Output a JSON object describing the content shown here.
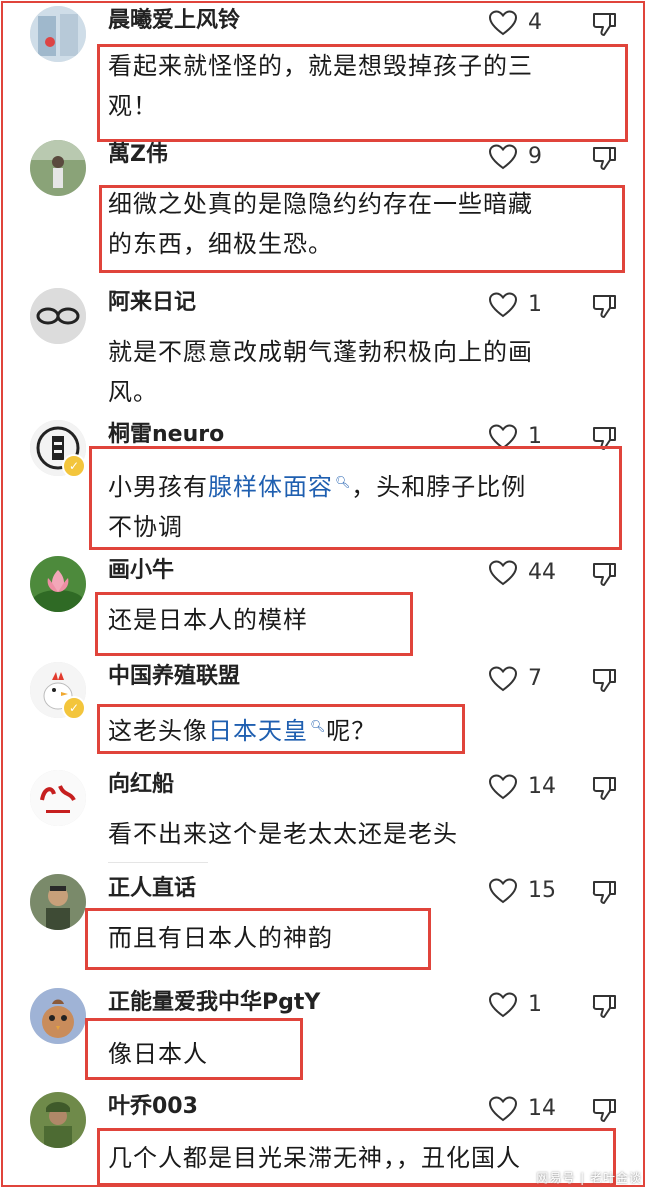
{
  "comments": [
    {
      "user": "晨曦爱上风铃",
      "likes": "4",
      "avatar": "window-scene-avatar",
      "text_lines": [
        "看起来就怪怪的，就是想毁掉孩子的三",
        "观！"
      ]
    },
    {
      "user": "萬Z伟",
      "likes": "9",
      "avatar": "person-outdoor-avatar",
      "text_lines": [
        "细微之处真的是隐隐约约存在一些暗藏",
        "的东西，细极生恐。"
      ]
    },
    {
      "user": "阿来日记",
      "likes": "1",
      "avatar": "glasses-avatar",
      "text_lines": [
        "就是不愿意改成朝气蓬勃积极向上的画",
        "风。"
      ]
    },
    {
      "user": "桐雷neuro",
      "likes": "1",
      "avatar": "calligraphy-seal-avatar",
      "verified": true,
      "text_pre": "小男孩有",
      "text_link": "腺样体面容",
      "text_post": "，头和脖子比例",
      "text_line2": "不协调"
    },
    {
      "user": "画小牛",
      "likes": "44",
      "avatar": "lotus-avatar",
      "text_lines": [
        "还是日本人的模样"
      ]
    },
    {
      "user": "中国养殖联盟",
      "likes": "7",
      "avatar": "rooster-avatar",
      "verified": true,
      "text_pre": "这老头像",
      "text_link": "日本天皇",
      "text_post": "呢？"
    },
    {
      "user": "向红船",
      "likes": "14",
      "avatar": "red-boat-logo-avatar",
      "text_lines": [
        "看不出来这个是老太太还是老头"
      ]
    },
    {
      "user": "正人直话",
      "likes": "15",
      "avatar": "man-portrait-avatar",
      "text_lines": [
        "而且有日本人的神韵"
      ]
    },
    {
      "user": "正能量爱我中华PgtY",
      "likes": "1",
      "avatar": "cartoon-bird-avatar",
      "text_lines": [
        "像日本人"
      ]
    },
    {
      "user": "叶乔003",
      "likes": "14",
      "avatar": "soldier-avatar",
      "text_lines": [
        "几个人都是目光呆滞无神，，丑化国人"
      ]
    }
  ],
  "colors": {
    "highlight": "#e0443b",
    "link": "#1f5fb0",
    "text": "#1a1a1a"
  },
  "watermark": "网易号 | 老叶金谈"
}
